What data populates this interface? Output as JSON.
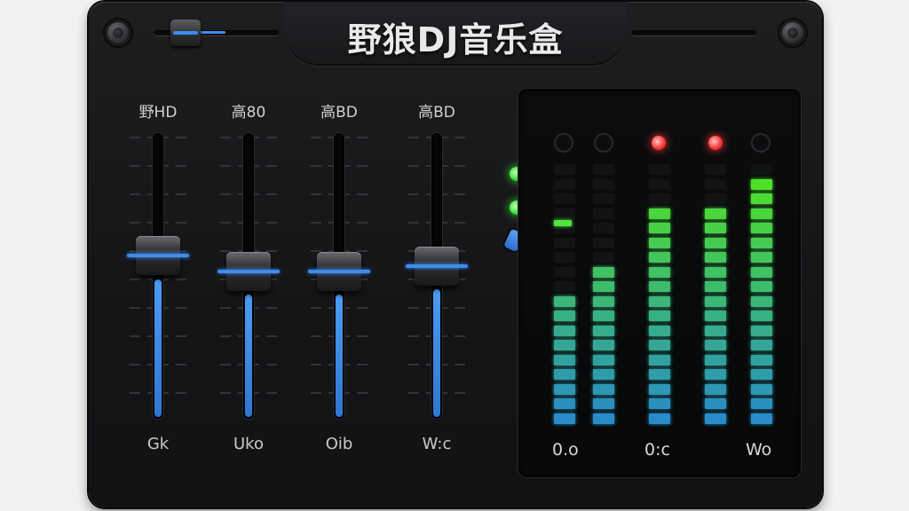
{
  "app": {
    "title": "野狼DJ音乐盒"
  },
  "master_slider": {
    "level": 0.6
  },
  "faders": [
    {
      "label": "野HD",
      "value": "Gk",
      "level": 0.55
    },
    {
      "label": "高80",
      "value": "Uko",
      "level": 0.5
    },
    {
      "label": "高BD",
      "value": "Oib",
      "level": 0.5
    },
    {
      "label": "高BD",
      "value": "W:c",
      "level": 0.52
    }
  ],
  "indicators": {
    "status_leds": [
      "green",
      "green"
    ],
    "colors": {
      "green": "#3fe23a",
      "red": "#ff3b3b",
      "accent": "#3d8cf0"
    }
  },
  "meters": {
    "channels": [
      {
        "peak": "off",
        "level": 0.52,
        "top_dot": 0.78
      },
      {
        "peak": "off",
        "level": 0.62
      },
      {
        "peak": "red",
        "level": 0.83
      },
      {
        "peak": "red",
        "level": 0.83
      },
      {
        "peak": "off",
        "level": 0.92
      }
    ],
    "labels": [
      "0.o",
      "0:c",
      "Wo"
    ]
  }
}
